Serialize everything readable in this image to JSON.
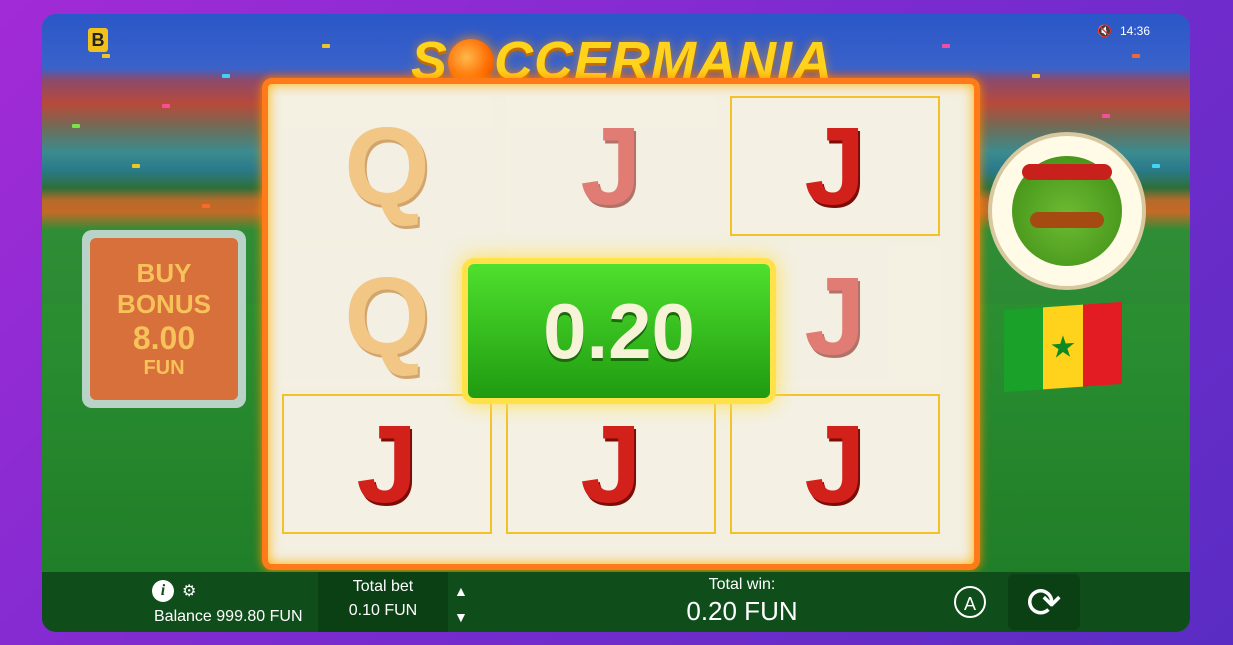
{
  "game": {
    "title_prefix": "S",
    "title_suffix": "CCERMANIA",
    "provider_logo": "B",
    "time": "14:36"
  },
  "buy_bonus": {
    "line1": "BUY",
    "line2": "BONUS",
    "amount": "8.00",
    "currency": "FUN"
  },
  "win_popup": {
    "amount": "0.20"
  },
  "reels": {
    "rows": [
      [
        "Q",
        "J",
        "J"
      ],
      [
        "Q",
        "",
        "J"
      ],
      [
        "J",
        "J",
        "J"
      ]
    ]
  },
  "bottom_bar": {
    "balance_label": "Balance 999.80 FUN",
    "total_bet_label": "Total bet",
    "total_bet_value": "0.10 FUN",
    "total_win_label": "Total win:",
    "total_win_value": "0.20 FUN",
    "auto_label": "A",
    "up_arrow": "▲",
    "down_arrow": "▼"
  },
  "icons": {
    "mute": "speaker-muted-icon",
    "info": "info-icon",
    "settings": "gear-icon",
    "spin": "spin-arrows-icon",
    "flag": "senegal-flag"
  },
  "colors": {
    "frame_border": "#ff7a18",
    "win_green": "#2fbf18",
    "symbol_red": "#d2201a",
    "symbol_orange": "#f2a63a"
  }
}
